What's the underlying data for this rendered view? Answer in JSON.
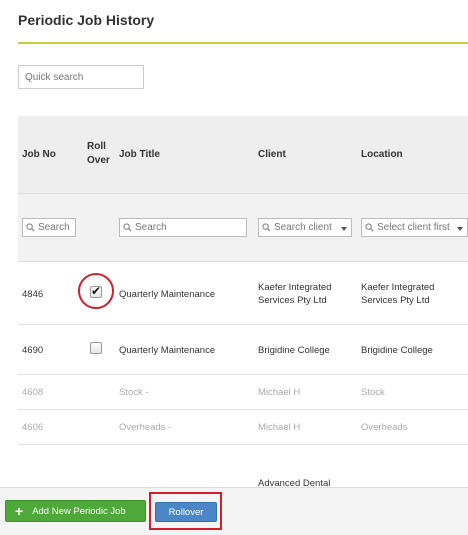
{
  "page": {
    "title": "Periodic Job History"
  },
  "quick_search": {
    "placeholder": "Quick search"
  },
  "columns": {
    "job_no": "Job No",
    "roll_over_1": "Roll",
    "roll_over_2": "Over",
    "job_title": "Job Title",
    "client": "Client",
    "location": "Location"
  },
  "filters": {
    "job_no": "Search",
    "job_title": "Search",
    "client": "Search client",
    "location": "Select client first"
  },
  "rows": [
    {
      "job_no": "4846",
      "roll_over": true,
      "job_title": "Quarterly Maintenance",
      "client_1": "Kaefer Integrated",
      "client_2": "Services Pty Ltd",
      "location_1": "Kaefer Integrated",
      "location_2": "Services Pty Ltd"
    },
    {
      "job_no": "4690",
      "roll_over": false,
      "job_title": "Quarterly Maintenance",
      "client_1": "Brigidine College",
      "location_1": "Brigidine College"
    },
    {
      "job_no": "4608",
      "job_title": "Stock -",
      "client_1": "Michael H",
      "location_1": "Stock"
    },
    {
      "job_no": "4606",
      "job_title": "Overheads -",
      "client_1": "Michael H",
      "location_1": "Overheads"
    },
    {
      "client_1": "Advanced Dental"
    }
  ],
  "footer": {
    "add_label": "Add New Periodic Job",
    "rollover_label": "Rollover"
  },
  "colors": {
    "accent_rule": "#c5cf3b",
    "add_button": "#4fa83a",
    "rollover_button": "#4b86c6",
    "highlight": "#d21e2d"
  }
}
